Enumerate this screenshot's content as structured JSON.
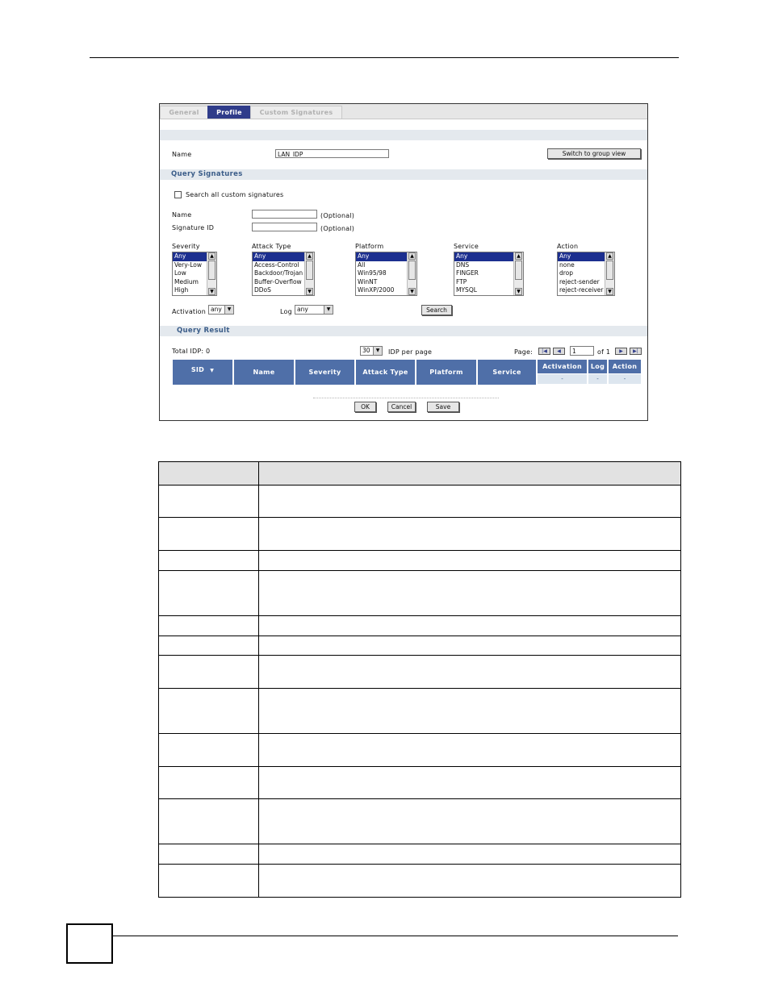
{
  "tabs": [
    {
      "label": "General",
      "active": false
    },
    {
      "label": "Profile",
      "active": true
    },
    {
      "label": "Custom Signatures",
      "active": false
    }
  ],
  "profile": {
    "name_label": "Name",
    "name_value": "LAN_IDP",
    "switch_button": "Switch to group view"
  },
  "query": {
    "section_title": "Query Signatures",
    "search_all_label": "Search all custom signatures",
    "name_label": "Name",
    "name_hint": "(Optional)",
    "sigid_label": "Signature ID",
    "sigid_hint": "(Optional)",
    "lists": [
      {
        "label": "Severity",
        "options": [
          "Any",
          "Very-Low",
          "Low",
          "Medium",
          "High"
        ]
      },
      {
        "label": "Attack Type",
        "options": [
          "Any",
          "Access-Control",
          "Backdoor/Trojan",
          "Buffer-Overflow",
          "DDoS"
        ]
      },
      {
        "label": "Platform",
        "options": [
          "Any",
          "All",
          "Win95/98",
          "WinNT",
          "WinXP/2000"
        ]
      },
      {
        "label": "Service",
        "options": [
          "Any",
          "DNS",
          "FINGER",
          "FTP",
          "MYSQL"
        ]
      },
      {
        "label": "Action",
        "options": [
          "Any",
          "none",
          "drop",
          "reject-sender",
          "reject-receiver"
        ]
      }
    ],
    "activation_label": "Activation",
    "activation_value": "any",
    "log_label": "Log",
    "log_value": "any",
    "search_button": "Search"
  },
  "result": {
    "section_title": "Query Result",
    "total_label": "Total IDP: 0",
    "per_page_value": "30",
    "per_page_label": "IDP per page",
    "page_label": "Page:",
    "page_value": "1",
    "page_of": "of 1",
    "columns": [
      "SID",
      "Name",
      "Severity",
      "Attack Type",
      "Platform",
      "Service",
      "Activation",
      "Log",
      "Action"
    ],
    "sub_cells": [
      "-",
      "-",
      "-"
    ]
  },
  "buttons": {
    "ok": "OK",
    "cancel": "Cancel",
    "save": "Save"
  },
  "desc_table_rows": 13
}
